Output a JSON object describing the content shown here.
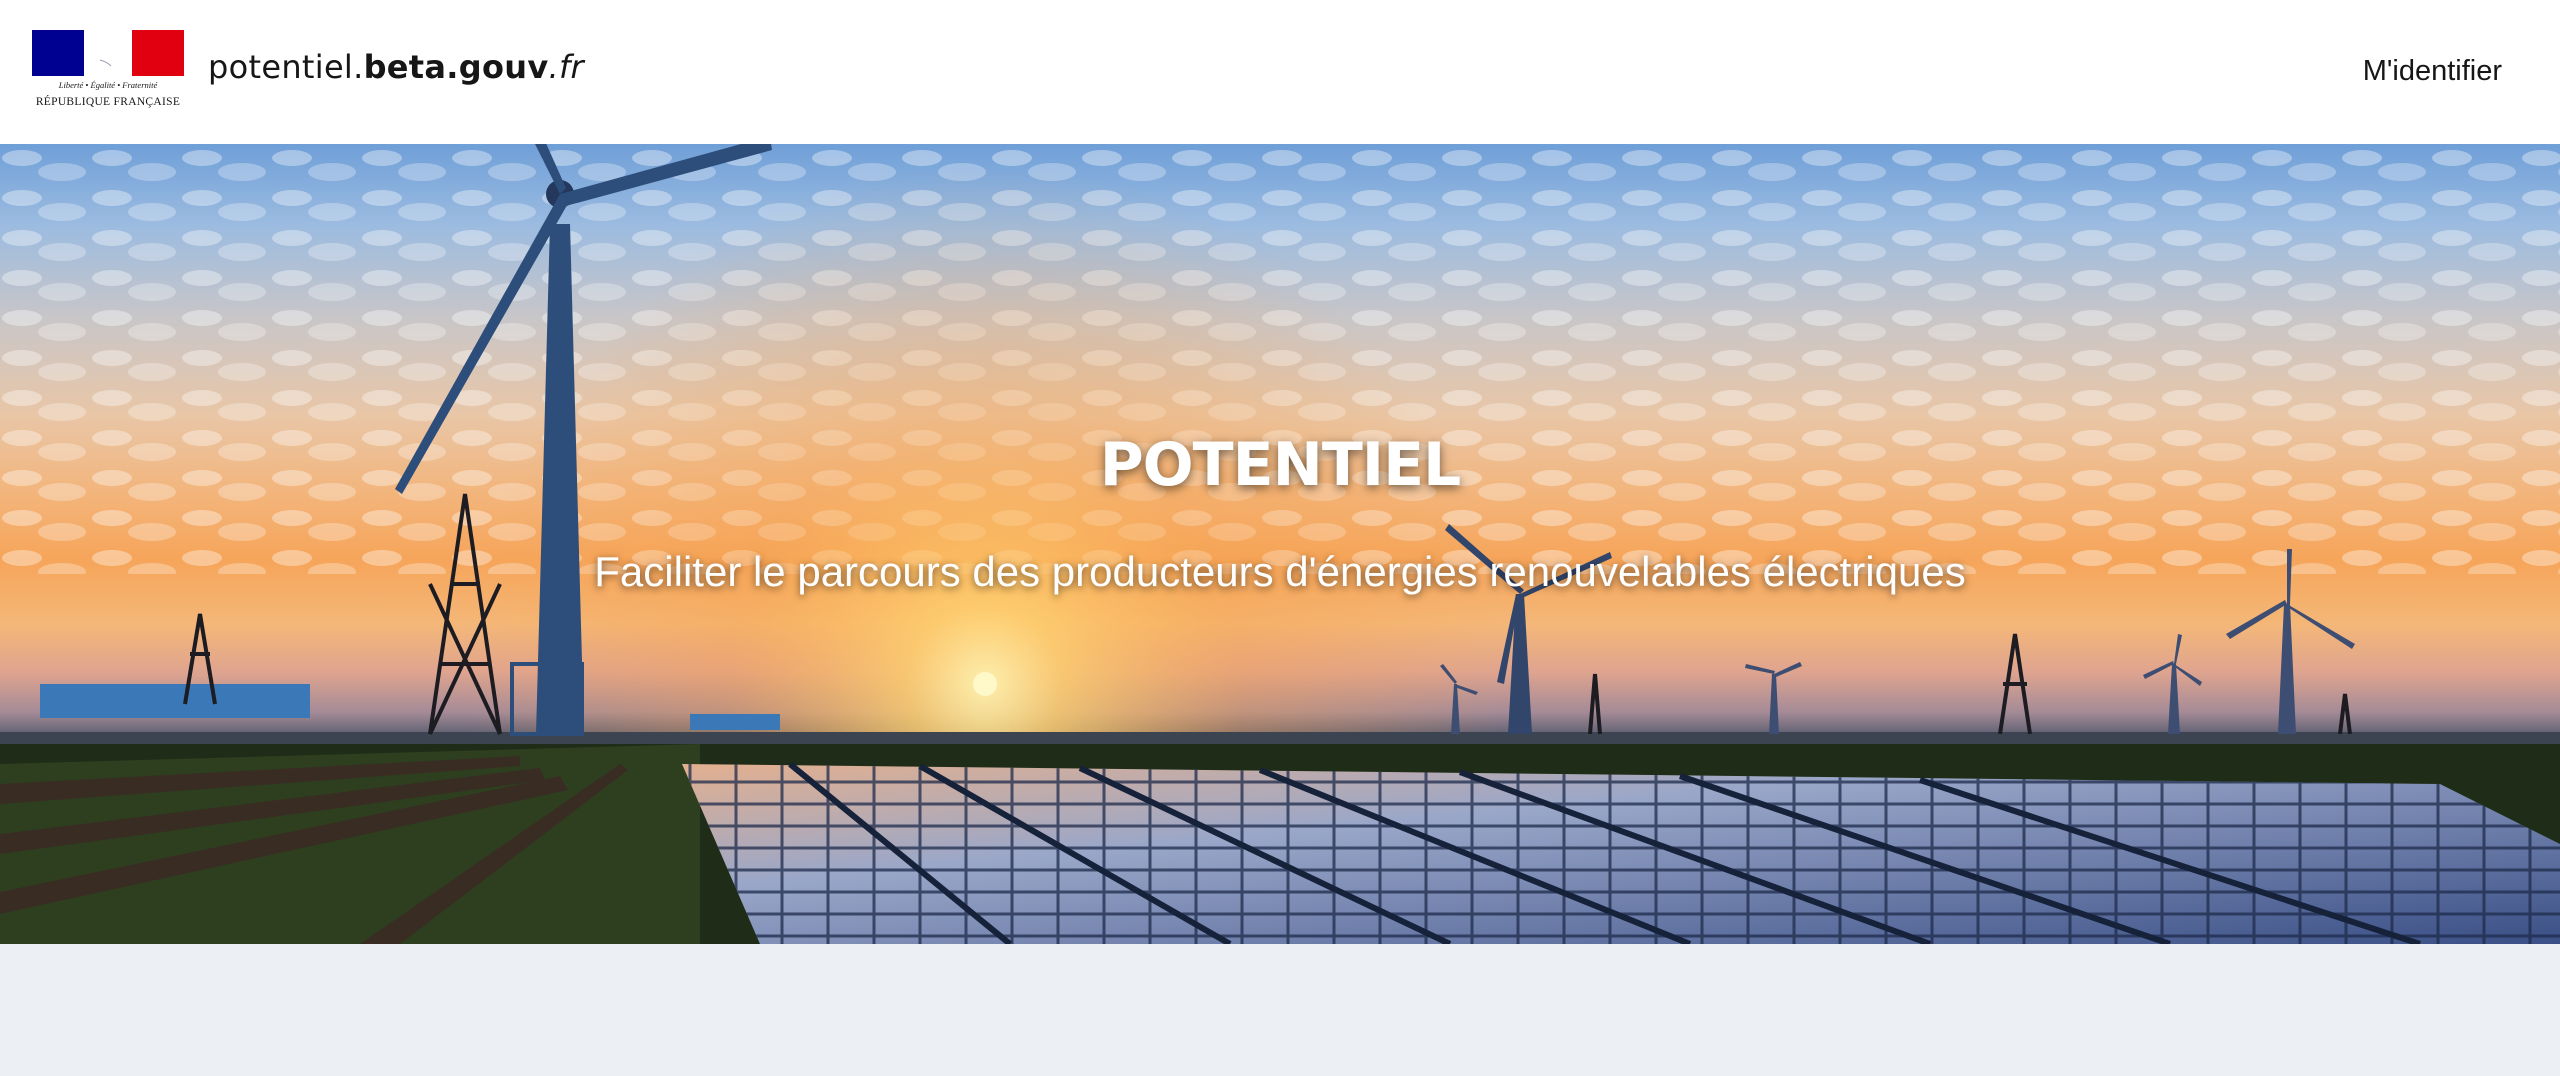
{
  "header": {
    "logo": {
      "devise": "Liberté • Égalité • Fraternité",
      "republique": "RÉPUBLIQUE FRANÇAISE",
      "flag_colors": [
        "#000091",
        "#ffffff",
        "#e1000f"
      ]
    },
    "site_name": {
      "prefix": "potentiel.",
      "bold": "beta.gouv",
      "suffix": ".fr"
    },
    "login_label": "M'identifier"
  },
  "hero": {
    "title": "POTENTIEL",
    "subtitle": "Faciliter le parcours des producteurs d'énergies renouvelables électriques",
    "image_subject": "wind-turbines-and-solar-panels-at-sunset"
  }
}
